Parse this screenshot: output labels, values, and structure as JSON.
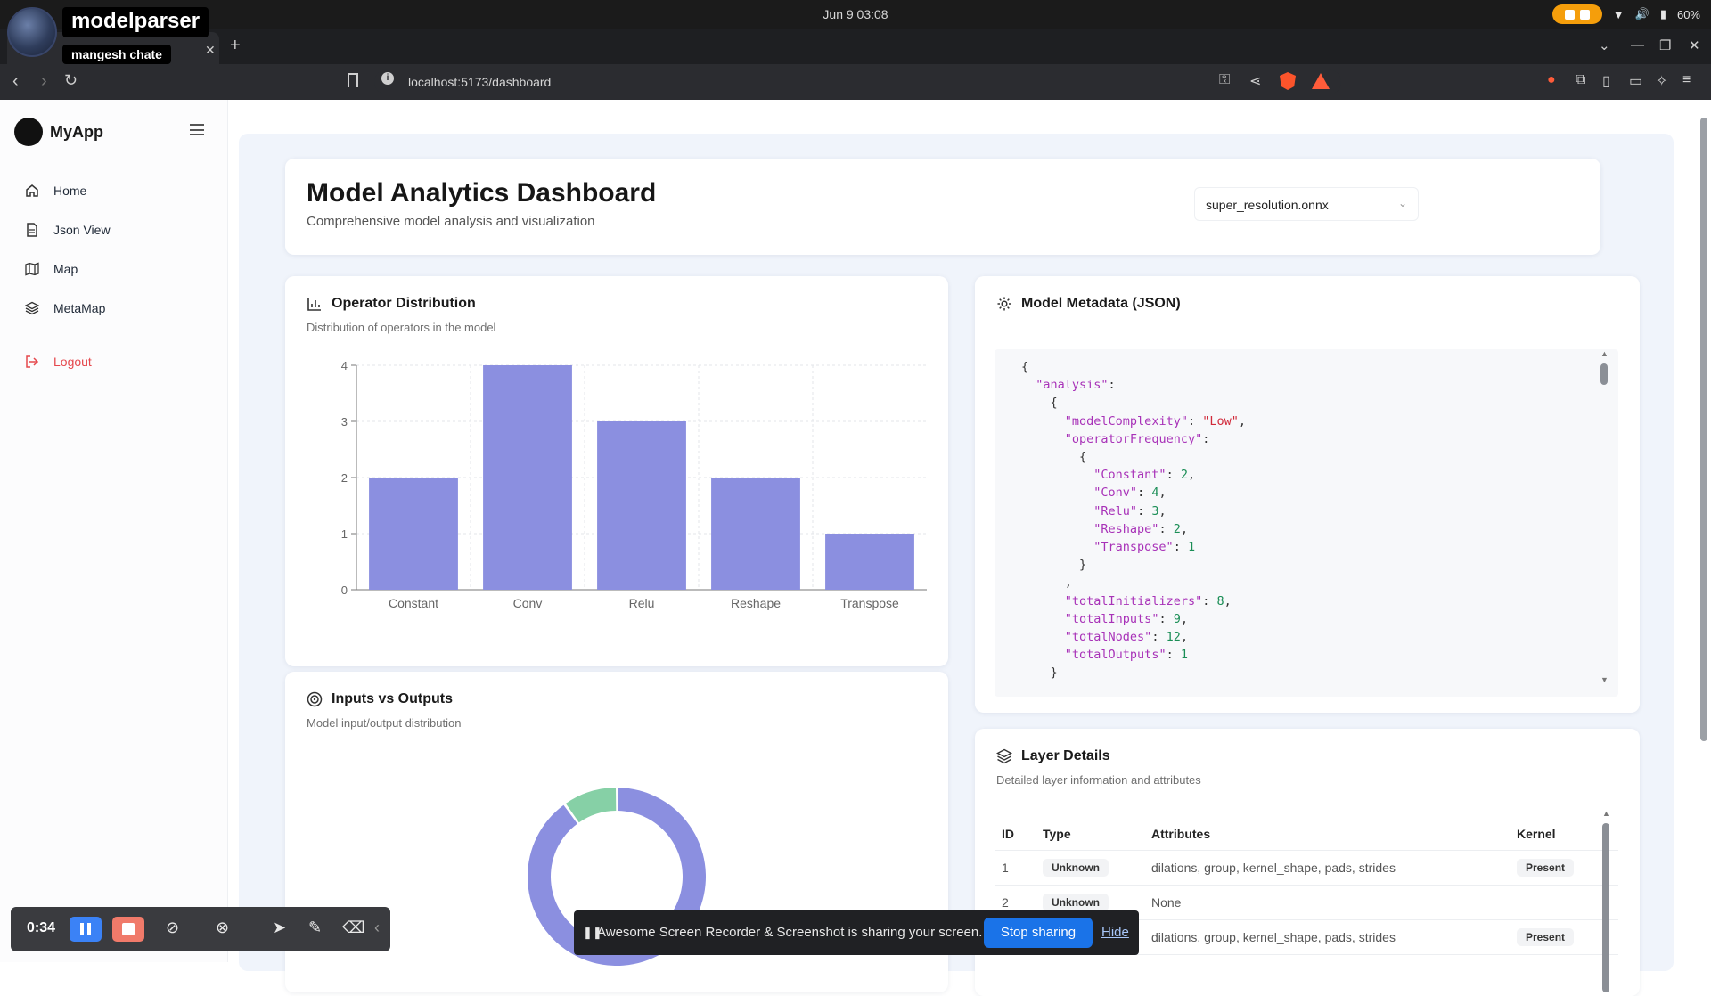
{
  "os": {
    "clock": "Jun 9  03:08",
    "battery": "60%"
  },
  "recorder_overlay": {
    "title": "modelparser",
    "subtitle": "mangesh chate"
  },
  "browser": {
    "url": "localhost:5173/dashboard",
    "ext_badge": "0:34"
  },
  "sidebar": {
    "brand": "MyApp",
    "items": [
      {
        "label": "Home",
        "icon": "home-icon"
      },
      {
        "label": "Json View",
        "icon": "file-icon"
      },
      {
        "label": "Map",
        "icon": "map-icon"
      },
      {
        "label": "MetaMap",
        "icon": "layers-icon"
      },
      {
        "label": "Logout",
        "icon": "logout-icon"
      }
    ]
  },
  "header": {
    "title": "Model Analytics Dashboard",
    "subtitle": "Comprehensive model analysis and visualization",
    "model_select": "super_resolution.onnx"
  },
  "operator_card": {
    "title": "Operator Distribution",
    "subtitle": "Distribution of operators in the model"
  },
  "chart_data": {
    "type": "bar",
    "categories": [
      "Constant",
      "Conv",
      "Relu",
      "Reshape",
      "Transpose"
    ],
    "values": [
      2,
      4,
      3,
      2,
      1
    ],
    "yticks": [
      "0",
      "1",
      "2",
      "3",
      "4"
    ],
    "ylim": [
      0,
      4
    ],
    "color": "#8b8fe0"
  },
  "io_card": {
    "title": "Inputs vs Outputs",
    "subtitle": "Model input/output distribution",
    "donut": {
      "inputs": 9,
      "outputs": 1,
      "colors": [
        "#8b8fe0",
        "#86d0a6"
      ]
    }
  },
  "metadata_card": {
    "title": "Model Metadata (JSON)",
    "json": {
      "modelComplexity": "\"Low\"",
      "Constant": "2",
      "Conv": "4",
      "Relu": "3",
      "Reshape": "2",
      "Transpose": "1",
      "totalInitializers": "8",
      "totalInputs": "9",
      "totalNodes": "12",
      "totalOutputs": "1"
    }
  },
  "layers_card": {
    "title": "Layer Details",
    "subtitle": "Detailed layer information and attributes",
    "columns": [
      "ID",
      "Type",
      "Attributes",
      "Kernel"
    ],
    "rows": [
      {
        "id": "1",
        "type": "Unknown",
        "attributes": "dilations, group, kernel_shape, pads, strides",
        "kernel": "Present"
      },
      {
        "id": "2",
        "type": "Unknown",
        "attributes": "None",
        "kernel": ""
      },
      {
        "id": "",
        "type": "",
        "attributes": "dilations, group, kernel_shape, pads, strides",
        "kernel": "Present"
      }
    ]
  },
  "recorder_toolbar": {
    "time": "0:34"
  },
  "share_bar": {
    "message": "Awesome Screen Recorder & Screenshot is sharing your screen.",
    "stop": "Stop sharing",
    "hide": "Hide"
  }
}
